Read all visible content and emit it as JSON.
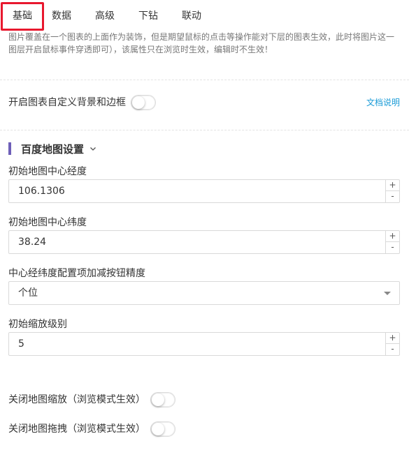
{
  "tabs": [
    {
      "label": "基础"
    },
    {
      "label": "数据"
    },
    {
      "label": "高级"
    },
    {
      "label": "下钻"
    },
    {
      "label": "联动"
    }
  ],
  "description": {
    "line1": "图片覆盖在一个图表的上面作为装饰，但是期望鼠标的点击等操作能对下层的图表生效，此时将图片这一",
    "line2": "图层开启鼠标事件穿透即可），该属性只在浏览时生效，编辑时不生效！"
  },
  "custom_bg": {
    "label": "开启图表自定义背景和边框",
    "enabled": false,
    "doc_link": "文档说明"
  },
  "section": {
    "title": "百度地图设置",
    "accent_color": "#6e5fb8",
    "icon": "chevron-down-icon"
  },
  "fields": {
    "longitude": {
      "label": "初始地图中心经度",
      "value": "106.1306"
    },
    "latitude": {
      "label": "初始地图中心纬度",
      "value": "38.24"
    },
    "precision": {
      "label": "中心经纬度配置项加减按钮精度",
      "value": "个位"
    },
    "zoom": {
      "label": "初始缩放级别",
      "value": "5"
    }
  },
  "stepper": {
    "plus": "+",
    "minus": "-"
  },
  "toggles": {
    "disable_zoom": {
      "label": "关闭地图缩放（浏览模式生效）",
      "enabled": false
    },
    "disable_drag": {
      "label": "关闭地图拖拽（浏览模式生效）",
      "enabled": false
    }
  },
  "colors": {
    "active_tab_border": "#e8182e",
    "link": "#1a9bd7"
  }
}
